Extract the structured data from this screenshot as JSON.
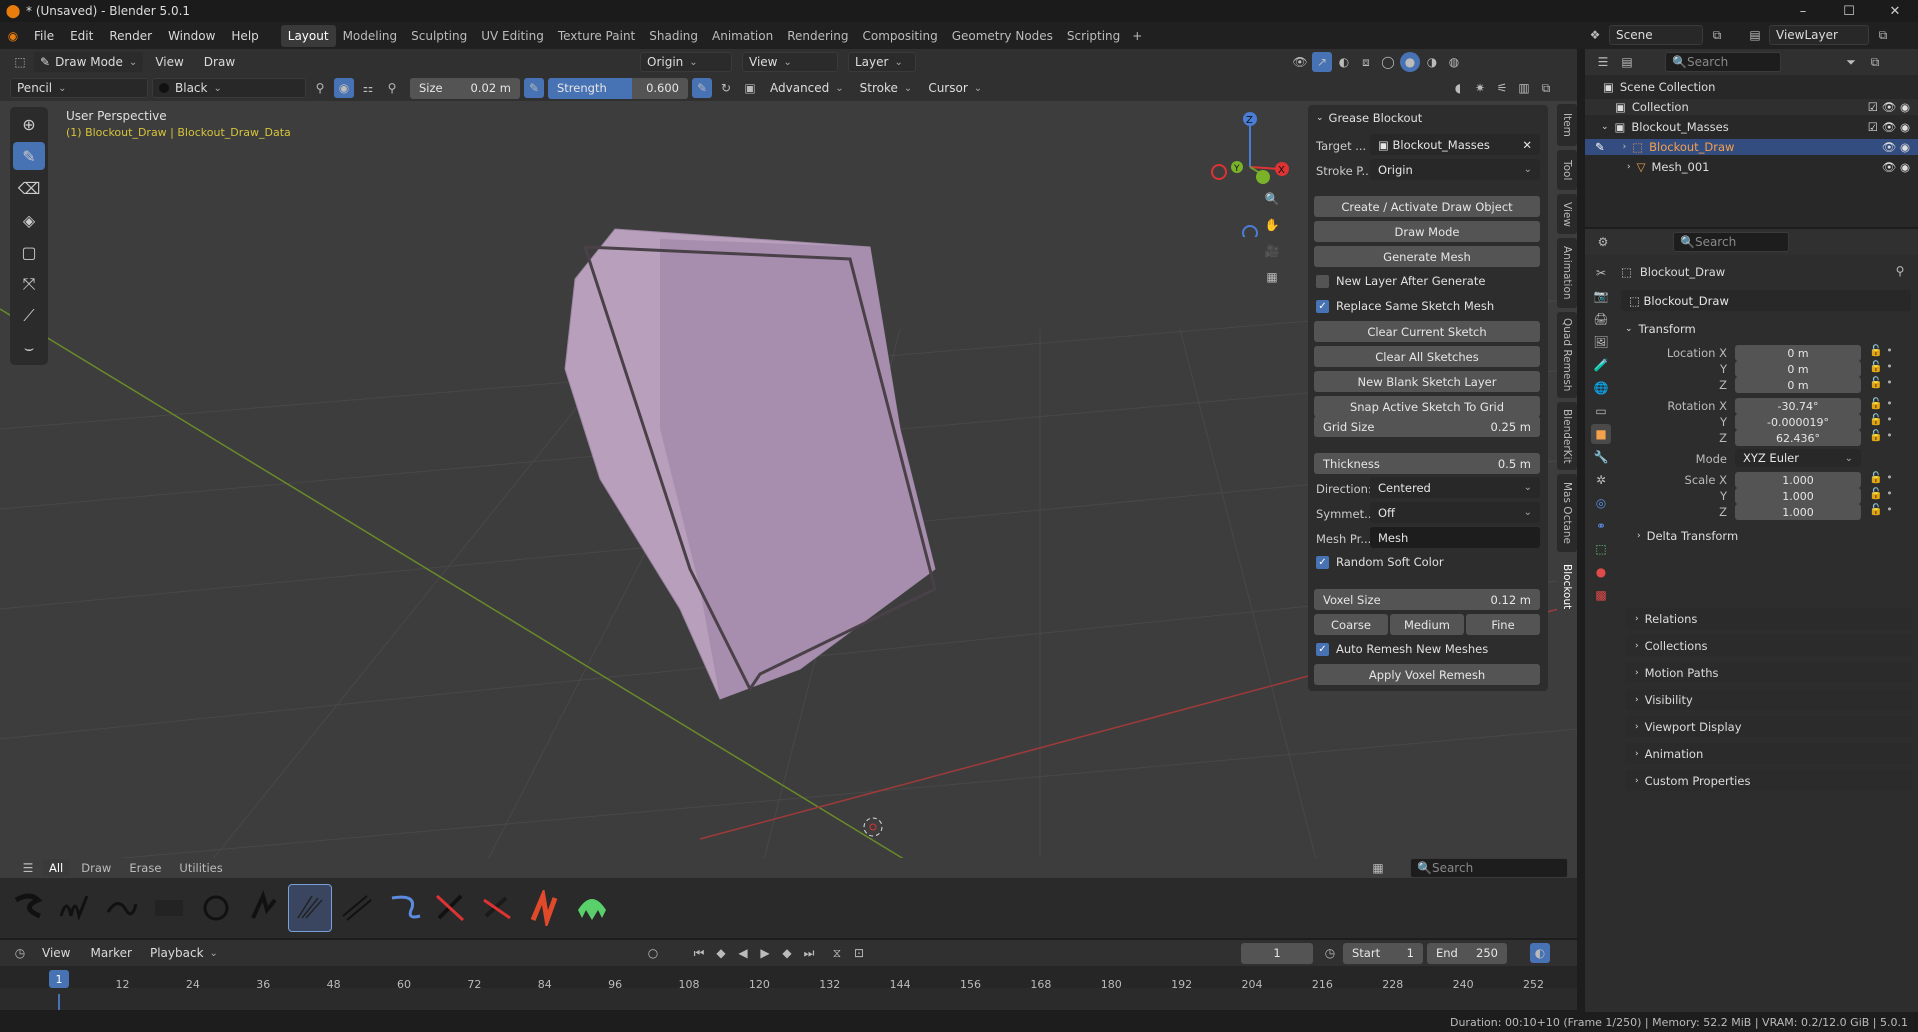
{
  "window": {
    "title": "* (Unsaved) - Blender 5.0.1",
    "controls": [
      "–",
      "☐",
      "✕"
    ]
  },
  "menu": [
    "File",
    "Edit",
    "Render",
    "Window",
    "Help"
  ],
  "workspaces": [
    "Layout",
    "Modeling",
    "Sculpting",
    "UV Editing",
    "Texture Paint",
    "Shading",
    "Animation",
    "Rendering",
    "Compositing",
    "Geometry Nodes",
    "Scripting"
  ],
  "scene": {
    "name": "Scene",
    "view_layer": "ViewLayer"
  },
  "viewport_header": {
    "mode": "Draw Mode",
    "view": "View",
    "draw": "Draw",
    "origin": "Origin",
    "view2": "View",
    "layer": "Layer"
  },
  "tool_header": {
    "brush": "Pencil",
    "color": "Black",
    "size_label": "Size",
    "size_value": "0.02 m",
    "strength_label": "Strength",
    "strength_value": "0.600",
    "advanced": "Advanced",
    "stroke": "Stroke",
    "cursor": "Cursor"
  },
  "viewport": {
    "perspective": "User Perspective",
    "object_info": "(1) Blockout_Draw | Blockout_Draw_Data",
    "mesh_color": "#b8a0bc"
  },
  "n_panel": {
    "title": "Grease Blockout",
    "target_label": "Target ...",
    "target_value": "Blockout_Masses",
    "stroke_label": "Stroke P...",
    "stroke_value": "Origin",
    "buttons": [
      "Create / Activate Draw Object",
      "Draw Mode",
      "Generate Mesh"
    ],
    "new_layer_after_generate": "New Layer After Generate",
    "replace_same_sketch_mesh": "Replace Same Sketch Mesh",
    "buttons2": [
      "Clear Current Sketch",
      "Clear All Sketches",
      "New Blank Sketch Layer",
      "Snap Active Sketch To Grid"
    ],
    "grid_size_label": "Grid Size",
    "grid_size_value": "0.25 m",
    "thickness_label": "Thickness",
    "thickness_value": "0.5 m",
    "direction_label": "Direction:",
    "direction_value": "Centered",
    "symmetry_label": "Symmet...",
    "symmetry_value": "Off",
    "mesh_prefix_label": "Mesh Pr...",
    "mesh_prefix_value": "Mesh",
    "random_soft_color": "Random Soft Color",
    "voxel_size_label": "Voxel Size",
    "voxel_size_value": "0.12 m",
    "quality": [
      "Coarse",
      "Medium",
      "Fine"
    ],
    "auto_remesh": "Auto Remesh New Meshes",
    "apply_voxel": "Apply Voxel Remesh"
  },
  "side_tabs": [
    "Item",
    "Tool",
    "View",
    "Animation",
    "Quad Remesh",
    "BlenderKit",
    "Mas Octane",
    "Blockout"
  ],
  "outliner": {
    "search_placeholder": "Search",
    "items": [
      "Scene Collection",
      "Collection",
      "Blockout_Masses",
      "Blockout_Draw",
      "Mesh_001"
    ]
  },
  "properties": {
    "search_placeholder": "Search",
    "object_name": "Blockout_Draw",
    "data_name": "Blockout_Draw",
    "transform": "Transform",
    "location_label": "Location X",
    "location": [
      "0 m",
      "0 m",
      "0 m"
    ],
    "rotation_label": "Rotation X",
    "rotation": [
      "-30.74°",
      "-0.000019°",
      "62.436°"
    ],
    "mode_label": "Mode",
    "mode_value": "XYZ Euler",
    "scale_label": "Scale X",
    "scale": [
      "1.000",
      "1.000",
      "1.000"
    ],
    "axis_y": "Y",
    "axis_z": "Z",
    "delta": "Delta Transform",
    "sections": [
      "Relations",
      "Collections",
      "Motion Paths",
      "Visibility",
      "Viewport Display",
      "Animation",
      "Custom Properties"
    ]
  },
  "asset_shelf": {
    "tabs": [
      "All",
      "Draw",
      "Erase",
      "Utilities"
    ],
    "search_placeholder": "Search"
  },
  "timeline": {
    "view": "View",
    "marker": "Marker",
    "playback": "Playback",
    "frame": "1",
    "start_label": "Start",
    "start": "1",
    "end_label": "End",
    "end": "250",
    "ticks": [
      "1",
      "12",
      "24",
      "36",
      "48",
      "60",
      "72",
      "84",
      "96",
      "108",
      "120",
      "132",
      "144",
      "156",
      "168",
      "180",
      "192",
      "204",
      "216",
      "228",
      "240",
      "252"
    ]
  },
  "status": "Duration: 00:10+10 (Frame 1/250) | Memory: 52.2 MiB | VRAM: 0.2/12.0 GiB | 5.0.1"
}
